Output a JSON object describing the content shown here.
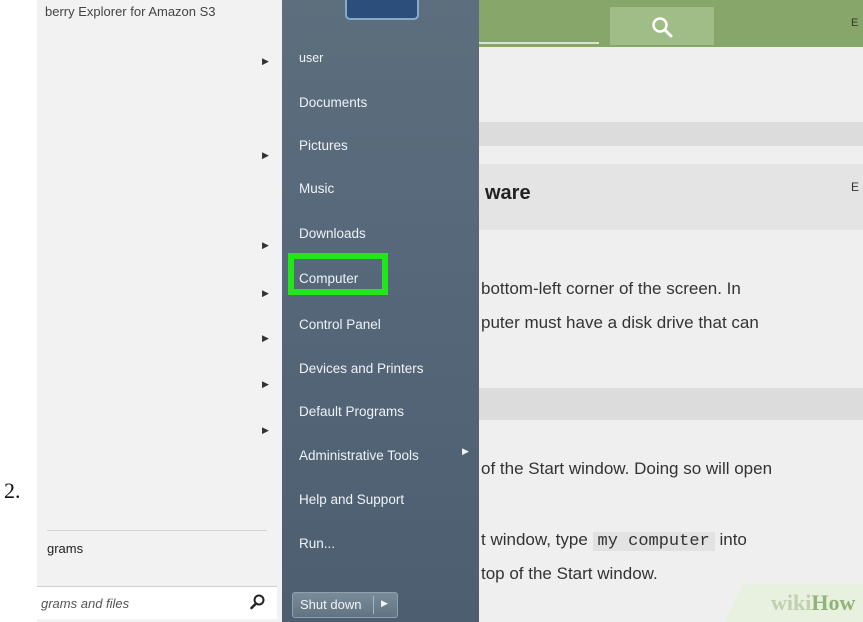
{
  "step_number": "2.",
  "programs_panel": {
    "top_item": "berry Explorer for Amazon S3",
    "all_programs": "grams",
    "search_placeholder": "grams and files"
  },
  "places": {
    "items": [
      "user",
      "Documents",
      "Pictures",
      "Music",
      "Downloads",
      "Computer",
      "Control Panel",
      "Devices and Printers",
      "Default Programs",
      "Administrative Tools",
      "Help and Support",
      "Run..."
    ],
    "highlighted": "Computer",
    "shutdown_label": "Shut down"
  },
  "background_page": {
    "heading": "ware",
    "corner_letter": "E",
    "line1": "bottom-left corner of the screen. In",
    "line2": "puter must have a disk drive that can",
    "line3": "of the Start window. Doing so will open",
    "line4_a": "t window, type",
    "line4_code": "my computer",
    "line4_b": "into",
    "line5": "top of the Start window.",
    "logo_part1": "wiki",
    "logo_part2": "How"
  },
  "colors": {
    "highlight": "#22e51c",
    "header_green": "#87a76a",
    "places_blue_gray": "#56687a"
  }
}
